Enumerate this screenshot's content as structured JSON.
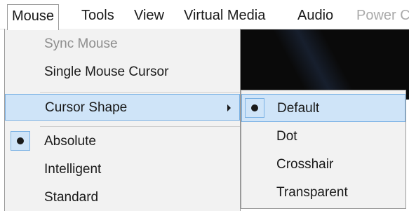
{
  "menubar": {
    "items": [
      {
        "label": "Mouse"
      },
      {
        "label": "Tools"
      },
      {
        "label": "View"
      },
      {
        "label": "Virtual Media"
      },
      {
        "label": "Audio"
      },
      {
        "label": "Power C"
      }
    ]
  },
  "mouse_menu": {
    "items": [
      {
        "label": "Sync Mouse",
        "enabled": false
      },
      {
        "label": "Single Mouse Cursor",
        "enabled": true
      },
      {
        "label": "Cursor Shape",
        "has_submenu": true,
        "highlighted": true
      },
      {
        "label": "Absolute",
        "selected": true
      },
      {
        "label": "Intelligent",
        "selected": false
      },
      {
        "label": "Standard",
        "selected": false
      }
    ]
  },
  "cursor_shape_submenu": {
    "items": [
      {
        "label": "Default",
        "selected": true,
        "highlighted": true
      },
      {
        "label": "Dot",
        "selected": false
      },
      {
        "label": "Crosshair",
        "selected": false
      },
      {
        "label": "Transparent",
        "selected": false
      }
    ]
  },
  "colors": {
    "highlight_bg": "#cfe4f8",
    "highlight_border": "#7ab1e4",
    "menu_bg": "#f2f2f2",
    "disabled_text": "#8d8d8d"
  },
  "icons": {
    "submenu_arrow": "chevron-right-icon",
    "radio": "radio-selected-icon"
  }
}
